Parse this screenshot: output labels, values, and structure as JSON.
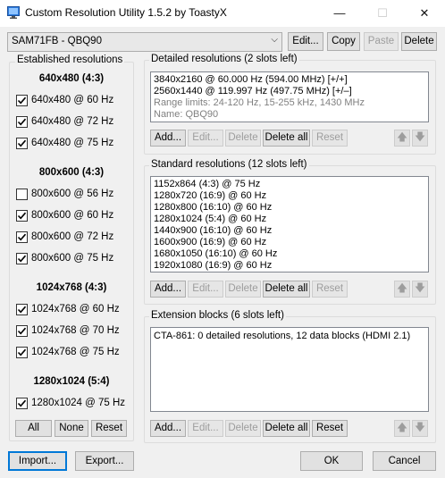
{
  "window": {
    "title": "Custom Resolution Utility 1.5.2 by ToastyX",
    "minimize": "—",
    "maximize": "☐",
    "close": "✕"
  },
  "monitor": {
    "selected": "SAM71FB - QBQ90",
    "buttons": {
      "edit": "Edit...",
      "copy": "Copy",
      "paste": "Paste",
      "delete": "Delete"
    }
  },
  "established": {
    "label": "Established resolutions",
    "groups": [
      {
        "title": "640x480 (4:3)",
        "items": [
          {
            "label": "640x480 @ 60 Hz",
            "checked": true
          },
          {
            "label": "640x480 @ 72 Hz",
            "checked": true
          },
          {
            "label": "640x480 @ 75 Hz",
            "checked": true
          }
        ]
      },
      {
        "title": "800x600 (4:3)",
        "items": [
          {
            "label": "800x600 @ 56 Hz",
            "checked": false
          },
          {
            "label": "800x600 @ 60 Hz",
            "checked": true
          },
          {
            "label": "800x600 @ 72 Hz",
            "checked": true
          },
          {
            "label": "800x600 @ 75 Hz",
            "checked": true
          }
        ]
      },
      {
        "title": "1024x768 (4:3)",
        "items": [
          {
            "label": "1024x768 @ 60 Hz",
            "checked": true
          },
          {
            "label": "1024x768 @ 70 Hz",
            "checked": true
          },
          {
            "label": "1024x768 @ 75 Hz",
            "checked": true
          }
        ]
      },
      {
        "title": "1280x1024 (5:4)",
        "items": [
          {
            "label": "1280x1024 @ 75 Hz",
            "checked": true
          }
        ]
      }
    ],
    "buttons": {
      "all": "All",
      "none": "None",
      "reset": "Reset"
    }
  },
  "detailed": {
    "label": "Detailed resolutions (2 slots left)",
    "lines": [
      "3840x2160 @ 60.000 Hz (594.00 MHz) [+/+]",
      "2560x1440 @ 119.997 Hz (497.75 MHz) [+/–]"
    ],
    "gray_lines": [
      "Range limits: 24-120 Hz, 15-255 kHz, 1430 MHz",
      "Name: QBQ90"
    ]
  },
  "standard": {
    "label": "Standard resolutions (12 slots left)",
    "lines": [
      "1152x864 (4:3) @ 75 Hz",
      "1280x720 (16:9) @ 60 Hz",
      "1280x800 (16:10) @ 60 Hz",
      "1280x1024 (5:4) @ 60 Hz",
      "1440x900 (16:10) @ 60 Hz",
      "1600x900 (16:9) @ 60 Hz",
      "1680x1050 (16:10) @ 60 Hz",
      "1920x1080 (16:9) @ 60 Hz"
    ]
  },
  "extension": {
    "label": "Extension blocks (6 slots left)",
    "lines": [
      "CTA-861: 0 detailed resolutions, 12 data blocks (HDMI 2.1)"
    ]
  },
  "list_buttons": {
    "add": "Add...",
    "edit": "Edit...",
    "delete": "Delete",
    "delete_all": "Delete all",
    "reset": "Reset",
    "up": "🡅",
    "down": "🡇"
  },
  "footer": {
    "import": "Import...",
    "export": "Export...",
    "ok": "OK",
    "cancel": "Cancel"
  },
  "colors": {
    "accent": "#0078d7",
    "app_icon": "#2d7de0"
  }
}
